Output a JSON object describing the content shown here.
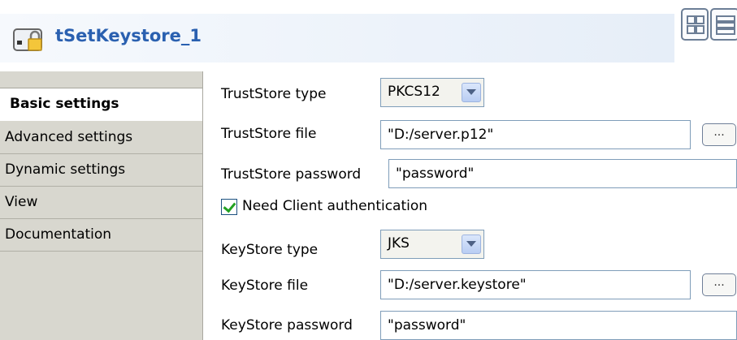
{
  "header": {
    "component_title": "tSetKeystore_1",
    "component_icon": "keystore-lock-icon",
    "layout_buttons": [
      "grid-layout-icon",
      "list-layout-icon"
    ]
  },
  "tabs": [
    {
      "label": "Basic settings",
      "active": true
    },
    {
      "label": "Advanced settings",
      "active": false
    },
    {
      "label": "Dynamic settings",
      "active": false
    },
    {
      "label": "View",
      "active": false
    },
    {
      "label": "Documentation",
      "active": false
    }
  ],
  "form": {
    "truststore_type": {
      "label": "TrustStore type",
      "value": "PKCS12"
    },
    "truststore_file": {
      "label": "TrustStore file",
      "value": "\"D:/server.p12\"",
      "browse_label": "..."
    },
    "truststore_password": {
      "label": "TrustStore password",
      "value": "\"password\""
    },
    "need_client_auth": {
      "label": "Need Client authentication",
      "checked": true
    },
    "keystore_type": {
      "label": "KeyStore type",
      "value": "JKS"
    },
    "keystore_file": {
      "label": "KeyStore file",
      "value": "\"D:/server.keystore\"",
      "browse_label": "..."
    },
    "keystore_password": {
      "label": "KeyStore password",
      "value": "\"password\""
    }
  },
  "colors": {
    "title": "#2a60b0",
    "tab_background": "#d8d7cf",
    "field_border": "#7f9db9",
    "check": "#21a121"
  }
}
